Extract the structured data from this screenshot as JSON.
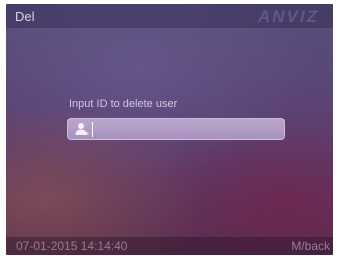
{
  "header": {
    "title": "Del",
    "logo_text": "ANVIZ"
  },
  "main": {
    "prompt": "Input ID to delete user",
    "input": {
      "value": "",
      "icon": "user-icon"
    }
  },
  "status_bar": {
    "datetime": "07-01-2015 14:14:40",
    "back_label": "M/back"
  },
  "colors": {
    "background_top": "#56507a",
    "background_bottom": "#5a2e4e",
    "input_fill": "#b9a6cc",
    "text": "#cfc8e4"
  }
}
